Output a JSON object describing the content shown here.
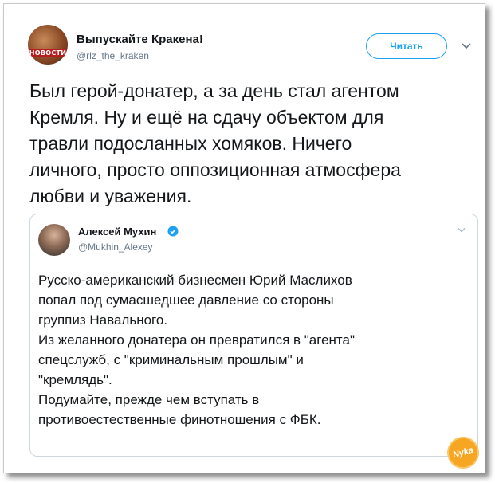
{
  "tweet": {
    "author_name": "Выпускайте Кракена!",
    "author_handle": "@rlz_the_kraken",
    "avatar_badge": "НОВОСТИ",
    "follow_label": "Читать",
    "text": "Был герой-донатер, а за день стал агентом\nКремля. Ну и ещё на сдачу объектом для\nтравли подосланных хомяков. Ничего\nличного, просто оппозиционная атмосфера\nлюбви и уважения."
  },
  "quoted_tweet": {
    "author_name": "Алексей Мухин",
    "author_handle": "@Mukhin_Alexey",
    "verified": true,
    "text": "Русско-американский бизнесмен Юрий Маслихов\nпопал под сумасшедшее давление со стороны\nгруппиз Навального.\nИз желанного донатера он превратился в \"агента\"\nспецслужб, с \"криминальным прошлым\" и\n\"кремлядь\".\nПодумайте, прежде чем вступать в\nпротивоестественные финотношения с ФБК."
  },
  "watermark": {
    "text": "Nyka"
  },
  "colors": {
    "accent": "#1da1f2",
    "text": "#14171a",
    "secondary_text": "#657786",
    "border": "#ccd6dd",
    "watermark": "#f6a623"
  },
  "icons": {
    "caret": "chevron-down-icon",
    "verified": "verified-badge-icon"
  }
}
